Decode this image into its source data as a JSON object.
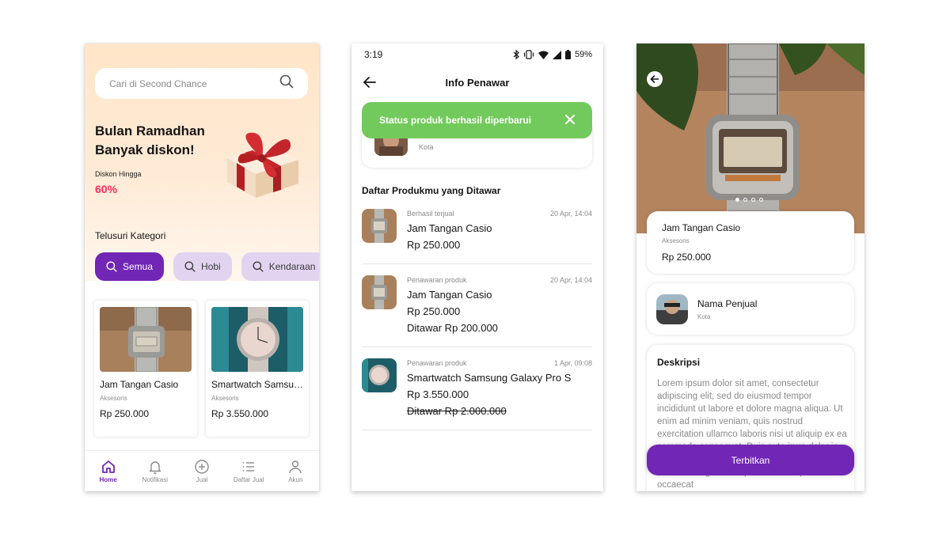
{
  "home": {
    "search": {
      "placeholder": "Cari di Second Chance",
      "icon": "search-icon"
    },
    "promo": {
      "title": "Bulan Ramadhan Banyak diskon!",
      "discount_label": "Diskon Hingga",
      "discount_value": "60%"
    },
    "category_title": "Telusuri Kategori",
    "categories": [
      {
        "label": "Semua",
        "active": true
      },
      {
        "label": "Hobi",
        "active": false
      },
      {
        "label": "Kendaraan",
        "active": false
      }
    ],
    "products": [
      {
        "name": "Jam Tangan Casio",
        "category": "Aksesoris",
        "price": "Rp 250.000"
      },
      {
        "name": "Smartwatch Samsung Galaxy Pro S",
        "category": "Aksesoris",
        "price": "Rp 3.550.000"
      }
    ],
    "nav": [
      {
        "label": "Home",
        "icon": "home-icon",
        "active": true
      },
      {
        "label": "Notifikasi",
        "icon": "bell-icon",
        "active": false
      },
      {
        "label": "Jual",
        "icon": "plus-circle-icon",
        "active": false
      },
      {
        "label": "Daftar Jual",
        "icon": "list-icon",
        "active": false
      },
      {
        "label": "Akun",
        "icon": "user-icon",
        "active": false
      }
    ]
  },
  "offers": {
    "status_bar": {
      "time": "3:19",
      "battery": "59%"
    },
    "title": "Info Penawar",
    "toast": "Status produk berhasil diperbarui",
    "buyer_city": "Kota",
    "list_title": "Daftar Produkmu yang Ditawar",
    "items": [
      {
        "label": "Berhasil terjual",
        "date": "20 Apr, 14:04",
        "name": "Jam Tangan Casio",
        "price": "Rp 250.000",
        "offer": ""
      },
      {
        "label": "Penawaran produk",
        "date": "20 Apr, 14:04",
        "name": "Jam Tangan Casio",
        "price": "Rp 250.000",
        "offer": "Ditawar Rp 200.000"
      },
      {
        "label": "Penawaran produk",
        "date": "1 Apr, 09:08",
        "name": "Smartwatch Samsung Galaxy Pro S",
        "price": "Rp 3.550.000",
        "offer": "Ditawar Rp 2.000.000"
      }
    ]
  },
  "detail": {
    "product": {
      "name": "Jam Tangan Casio",
      "category": "Aksesoris",
      "price": "Rp 250.000"
    },
    "seller": {
      "name": "Nama Penjual",
      "city": "Kota"
    },
    "description_title": "Deskripsi",
    "description": "Lorem ipsum dolor sit amet, consectetur adipiscing elit, sed do eiusmod tempor incididunt ut labore et dolore magna aliqua. Ut enim ad minim veniam, quis nostrud exercitation ullamco laboris nisi ut aliquip ex ea commodo consequat. Duis aute irure dolor in reprehenderit in voluptate velit esse cillum dolore eu fugiat nulla pariatur. Excepteur sint occaecat",
    "publish_label": "Terbitkan"
  },
  "colors": {
    "primary": "#7126B5",
    "primary_light": "#E2D4F0",
    "success": "#73CA5C",
    "danger": "#FA2C5A"
  }
}
